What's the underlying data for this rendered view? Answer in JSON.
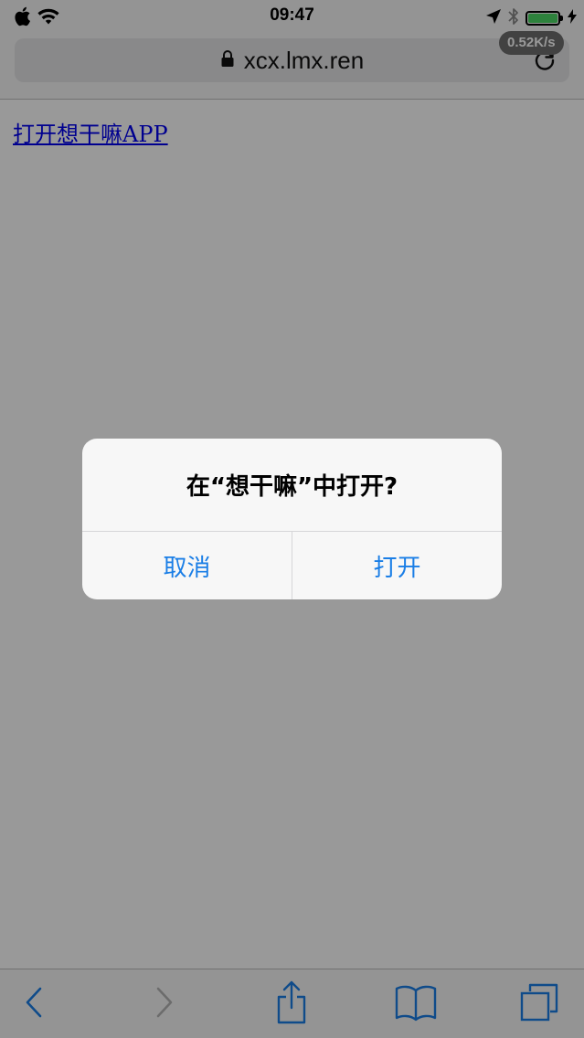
{
  "status_bar": {
    "time": "09:47",
    "network_speed": "0.52K/s",
    "battery_level": 1.0,
    "battery_color": "#4cd964",
    "icons": [
      "apple-icon",
      "wifi-icon",
      "location-arrow-icon",
      "bluetooth-icon",
      "battery-icon",
      "charging-bolt-icon"
    ]
  },
  "address_bar": {
    "url": "xcx.lmx.ren",
    "icons": [
      "lock-icon",
      "reload-icon"
    ]
  },
  "page": {
    "link_text": "打开想干嘛APP",
    "link_color": "#0000ee"
  },
  "alert": {
    "title": "在“想干嘛”中打开?",
    "cancel_label": "取消",
    "confirm_label": "打开",
    "button_color": "#1a7ee6"
  },
  "toolbar": {
    "icons": [
      "back-icon",
      "forward-icon",
      "share-icon",
      "bookmarks-icon",
      "tabs-icon"
    ],
    "forward_disabled": true
  }
}
